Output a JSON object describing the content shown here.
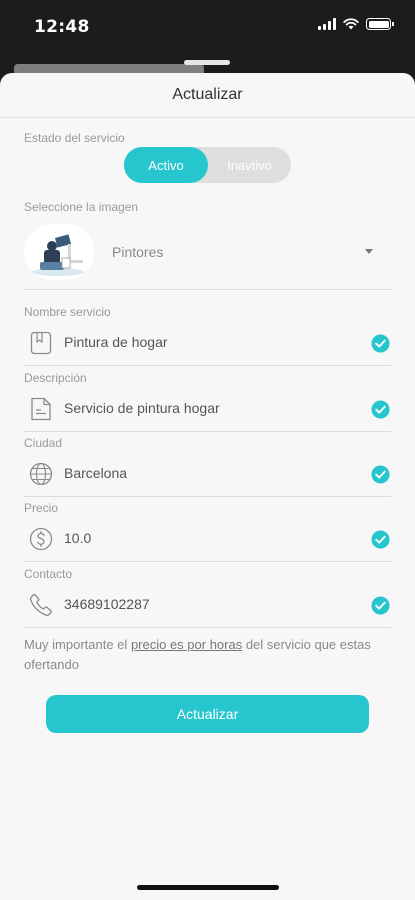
{
  "status_bar": {
    "time": "12:48",
    "icons": [
      "signal-icon",
      "wifi-icon",
      "battery-icon"
    ]
  },
  "sheet": {
    "title": "Actualizar"
  },
  "service_status": {
    "label": "Estado del servicio",
    "active_label": "Activo",
    "inactive_label": "Inavtivo",
    "selected": "Activo"
  },
  "image_select": {
    "label": "Seleccione la imagen",
    "selected_value": "Pintores",
    "thumbnail": "painter-illustration"
  },
  "fields": [
    {
      "label": "Nombre servicio",
      "value": "Pintura de hogar",
      "icon": "book-icon"
    },
    {
      "label": "Descripción",
      "value": "Servicio de pintura hogar",
      "icon": "document-icon"
    },
    {
      "label": "Ciudad",
      "value": "Barcelona",
      "icon": "globe-icon"
    },
    {
      "label": "Precio",
      "value": "10.0",
      "icon": "dollar-icon"
    },
    {
      "label": "Contacto",
      "value": "34689102287",
      "icon": "phone-icon"
    }
  ],
  "note": {
    "prefix": "Muy importante el ",
    "link": "precio es por horas",
    "suffix": " del servicio que estas ofertando"
  },
  "submit_button": {
    "label": "Actualizar"
  },
  "colors": {
    "accent": "#27c6cf",
    "toggle_off": "#dedede",
    "background": "#f7f7f7"
  }
}
